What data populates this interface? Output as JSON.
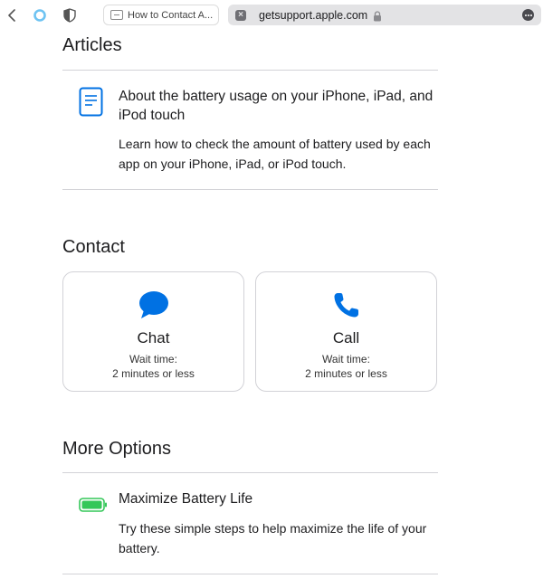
{
  "browser": {
    "inactive_tab_title": "How to Contact A...",
    "address": "getsupport.apple.com",
    "icons": [
      "chevron-left-icon",
      "circle-icon",
      "shield-icon",
      "page-icon",
      "close-icon",
      "lock-icon",
      "more-icon"
    ]
  },
  "articles": {
    "heading": "Articles",
    "items": [
      {
        "title": "About the battery usage on your iPhone, iPad, and iPod touch",
        "description": "Learn how to check the amount of battery used by each app on your iPhone, iPad, or iPod touch.",
        "icon": "document-icon"
      }
    ]
  },
  "contact": {
    "heading": "Contact",
    "options": [
      {
        "label": "Chat",
        "wait_label": "Wait time:",
        "wait_value": "2 minutes or less",
        "icon": "chat-bubble-icon"
      },
      {
        "label": "Call",
        "wait_label": "Wait time:",
        "wait_value": "2 minutes or less",
        "icon": "phone-icon"
      }
    ]
  },
  "more_options": {
    "heading": "More Options",
    "items": [
      {
        "title": "Maximize Battery Life",
        "description": "Try these simple steps to help maximize the life of your battery.",
        "icon": "battery-icon"
      }
    ]
  },
  "colors": {
    "accent_blue": "#0071e3",
    "battery_green": "#34c759",
    "divider": "#d2d2d7"
  }
}
